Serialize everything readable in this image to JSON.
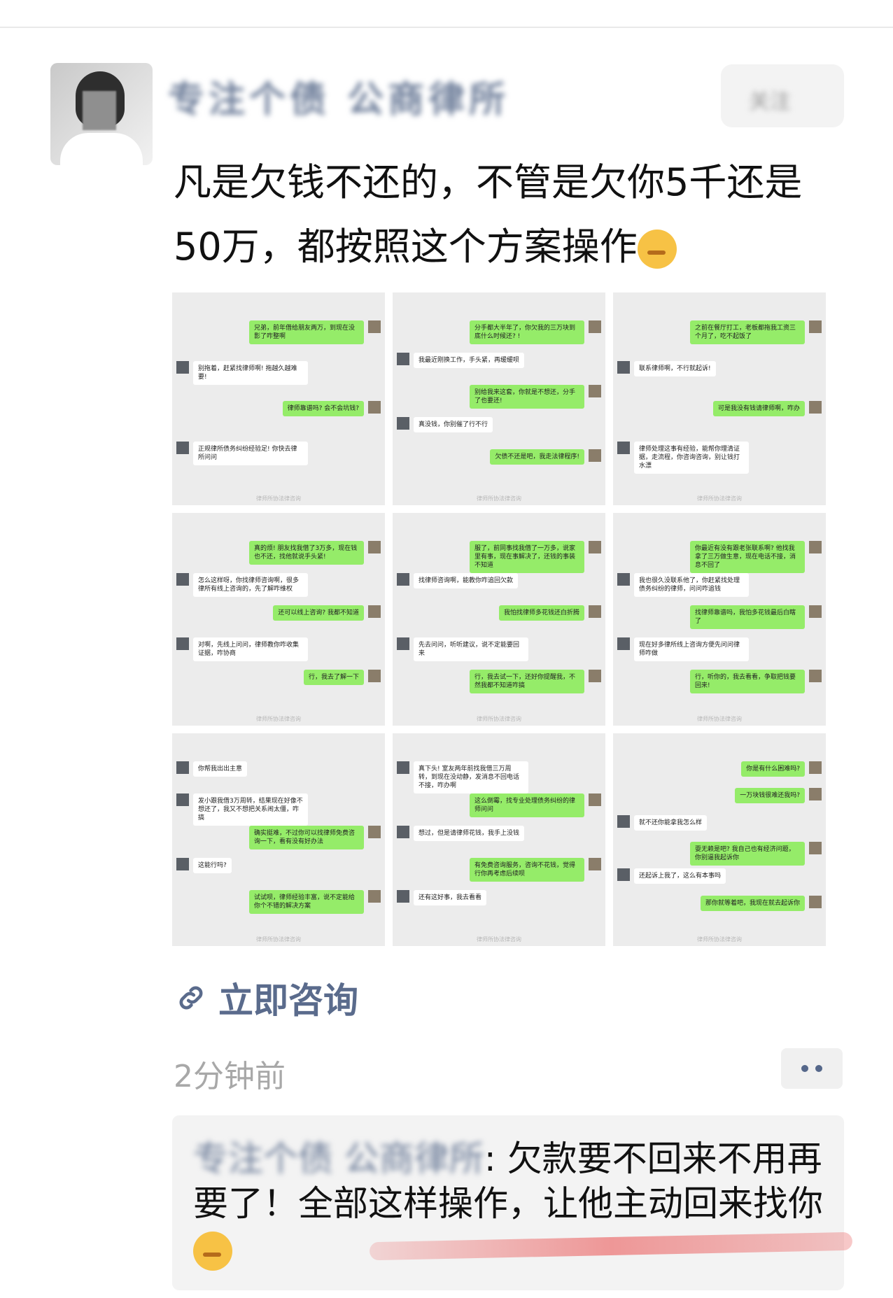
{
  "post": {
    "author_name": "专注个债 公商律所",
    "follow_label": "关注",
    "text": "凡是欠钱不还的，不管是欠你5千还是50万，都按照这个方案操作",
    "consult_label": "立即咨询",
    "time": "2分钟前"
  },
  "comment": {
    "author": "专注个债 公商律所",
    "text": ": 欠款要不回来不用再要了！全部这样操作，让他主动回来找你"
  },
  "watermark": "律师所协法律咨询",
  "shots": [
    [
      {
        "side": "right",
        "text": "兄弟，前年借给朋友两万，到现在没影了咋整啊"
      },
      {
        "side": "left",
        "text": "别拖着，赶紧找律师啊! 拖越久越难要!"
      },
      {
        "side": "right",
        "text": "律师靠谱吗? 会不会坑钱?"
      },
      {
        "side": "left",
        "text": "正规律所债务纠纷经验足! 你快去律所问问"
      }
    ],
    [
      {
        "side": "right",
        "text": "分手都大半年了，你欠我的三万块到底什么时候还? !"
      },
      {
        "side": "left",
        "text": "我最近刚换工作，手头紧，再缓缓呗"
      },
      {
        "side": "right",
        "text": "别给我来这套，你就是不想还，分手了也要还!"
      },
      {
        "side": "left",
        "text": "真没钱，你别催了行不行"
      },
      {
        "side": "right",
        "text": "欠债不还是吧，我走法律程序!"
      }
    ],
    [
      {
        "side": "right",
        "text": "之前在餐厅打工，老板都拖我工资三个月了，吃不起饭了"
      },
      {
        "side": "left",
        "text": "联系律师啊，不行就起诉!"
      },
      {
        "side": "right",
        "text": "可是我没有钱请律师啊，咋办"
      },
      {
        "side": "left",
        "text": "律师处理这事有经验，能帮你理清证据，走流程，你咨询咨询，别让钱打水漂"
      }
    ],
    [
      {
        "side": "right",
        "text": "真的烦! 朋友找我借了3万多，现在钱也不还，找他就说手头紧!"
      },
      {
        "side": "left",
        "text": "怎么这样呀，你找律师咨询啊，很多律所有线上咨询的，先了解咋维权"
      },
      {
        "side": "right",
        "text": "还可以线上咨询? 我都不知道"
      },
      {
        "side": "left",
        "text": "对啊，先线上问问，律师教你咋收集证据，咋协商"
      },
      {
        "side": "right",
        "text": "行，我去了解一下"
      }
    ],
    [
      {
        "side": "right",
        "text": "服了，前同事找我借了一万多，说家里有事，现在事解决了，还钱的事装不知道"
      },
      {
        "side": "left",
        "text": "找律师咨询啊，能教你咋追回欠款"
      },
      {
        "side": "right",
        "text": "我怕找律师多花钱还白折腾"
      },
      {
        "side": "left",
        "text": "先去问问，听听建议，说不定能要回来"
      },
      {
        "side": "right",
        "text": "行，我去试一下，还好你提醒我，不然我都不知道咋搞"
      }
    ],
    [
      {
        "side": "right",
        "text": "你最近有没有跟老张联系啊? 他找我拿了三万做生意，现在电话不接，消息不回了"
      },
      {
        "side": "left",
        "text": "我也很久没联系他了，你赶紧找处理债务纠纷的律师，问问咋追钱"
      },
      {
        "side": "right",
        "text": "找律师靠谱吗，我怕多花钱最后白瞎了"
      },
      {
        "side": "left",
        "text": "现在好多律所线上咨询方便先问问律师咋做"
      },
      {
        "side": "right",
        "text": "行，听你的，我去看看，争取把钱要回来!"
      }
    ],
    [
      {
        "side": "left",
        "text": "你帮我出出主意"
      },
      {
        "side": "left",
        "text": "发小跟我借3万周转，结果现在好像不想还了，我又不想把关系闹太僵，咋搞"
      },
      {
        "side": "right",
        "text": "确实挺难，不过你可以找律师免费咨询一下，看有没有好办法"
      },
      {
        "side": "left",
        "text": "这能行吗?"
      },
      {
        "side": "right",
        "text": "试试呗，律师经验丰富，说不定能给你个不错的解决方案"
      }
    ],
    [
      {
        "side": "left",
        "text": "真下头! 室友两年前找我借三万周转，到现在没动静，发消息不回电话不接，咋办啊"
      },
      {
        "side": "right",
        "text": "这么倒霉，找专业处理债务纠纷的律师问问"
      },
      {
        "side": "left",
        "text": "想过，但是请律师花钱，我手上没钱"
      },
      {
        "side": "right",
        "text": "有免费咨询服务，咨询不花钱，觉得行你再考虑后续呗"
      },
      {
        "side": "left",
        "text": "还有这好事，我去看看"
      }
    ],
    [
      {
        "side": "right",
        "text": "你是有什么困难吗?"
      },
      {
        "side": "right",
        "text": "一万块钱很难还我吗?"
      },
      {
        "side": "left",
        "text": "就不还你能拿我怎么样"
      },
      {
        "side": "right",
        "text": "耍无赖是吧? 我自己也有经济问题，你别逼我起诉你"
      },
      {
        "side": "left",
        "text": "还起诉上我了，这么有本事吗"
      },
      {
        "side": "right",
        "text": "那你就等着吧，我现在就去起诉你"
      }
    ]
  ]
}
